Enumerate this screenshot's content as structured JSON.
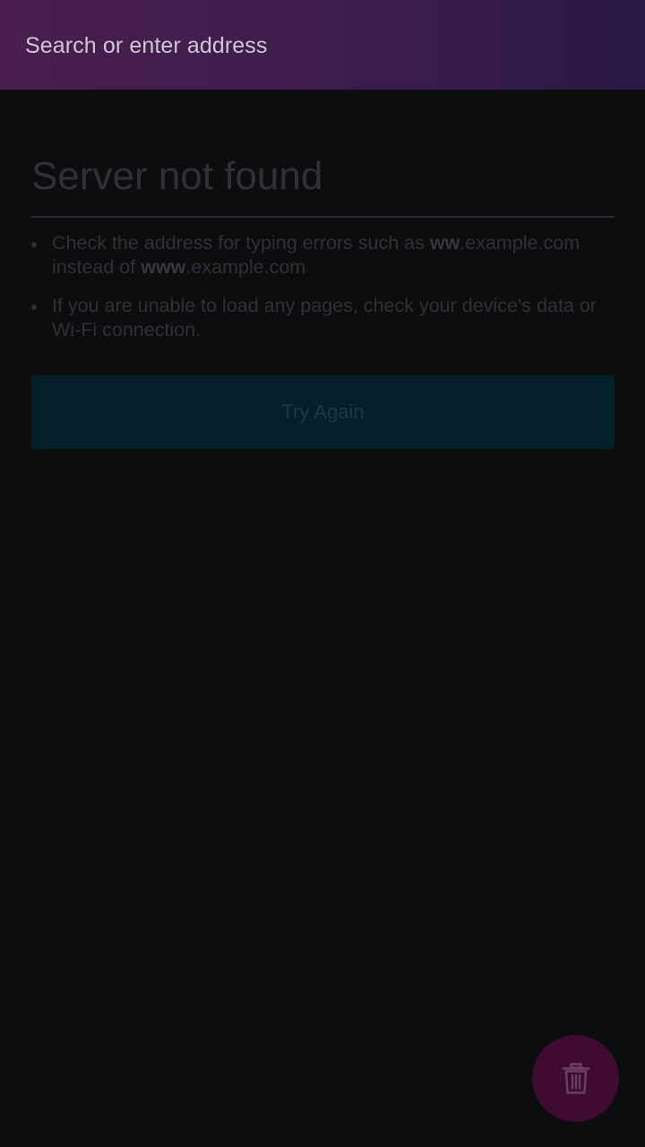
{
  "url_bar": {
    "placeholder": "Search or enter address"
  },
  "error_page": {
    "title": "Server not found",
    "tips": [
      {
        "part1": "Check the address for typing errors such as ",
        "bold1": "ww",
        "part2": ".example.com instead of ",
        "bold2": "www",
        "part3": ".example.com"
      },
      {
        "text": "If you are unable to load any pages, check your device’s data or Wi-Fi connection."
      }
    ],
    "try_again_label": "Try Again"
  },
  "fab": {
    "icon": "trash-icon"
  },
  "colors": {
    "toolbar_gradient_start": "#4a1f4f",
    "toolbar_gradient_end": "#2a1a45",
    "background": "#0c0d0f",
    "try_again_bg": "#03202b",
    "fab_bg": "#400b30"
  }
}
